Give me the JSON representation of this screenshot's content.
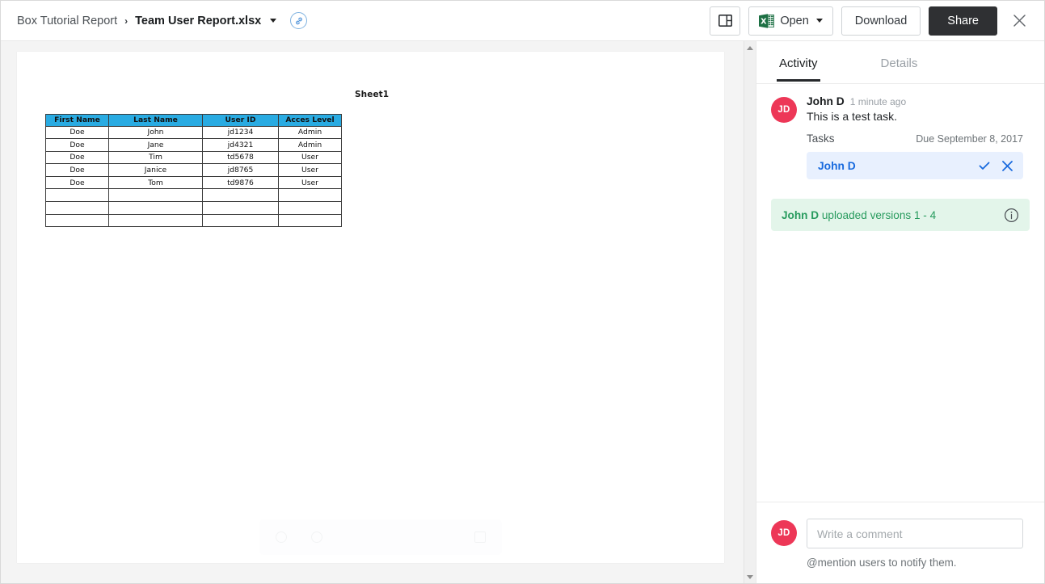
{
  "header": {
    "breadcrumb": {
      "parent": "Box Tutorial Report",
      "separator": "›",
      "current": "Team User Report.xlsx",
      "link_icon": "link-circle-icon",
      "caret_icon": "chevron-down-icon"
    },
    "actions": {
      "sidebar_toggle_icon": "sidebar-panel-icon",
      "open_label": "Open",
      "open_icon": "excel-file-icon",
      "download_label": "Download",
      "share_label": "Share",
      "close_icon": "close-icon"
    }
  },
  "viewer": {
    "sheet_label": "Sheet1",
    "zoom_out_icon": "zoom-out-icon",
    "zoom_in_icon": "zoom-in-icon",
    "fullscreen_icon": "fullscreen-icon",
    "scrollbar": {
      "up_icon": "scroll-up-arrow-icon",
      "down_icon": "scroll-down-arrow-icon"
    },
    "spreadsheet": {
      "headers": [
        "First Name",
        "Last Name",
        "User ID",
        "Acces Level"
      ],
      "header_bg": "#29abe2",
      "rows": [
        [
          "Doe",
          "John",
          "jd1234",
          "Admin"
        ],
        [
          "Doe",
          "Jane",
          "jd4321",
          "Admin"
        ],
        [
          "Doe",
          "Tim",
          "td5678",
          "User"
        ],
        [
          "Doe",
          "Janice",
          "jd8765",
          "User"
        ],
        [
          "Doe",
          "Tom",
          "td9876",
          "User"
        ],
        [
          "",
          "",
          "",
          ""
        ],
        [
          "",
          "",
          "",
          ""
        ],
        [
          "",
          "",
          "",
          ""
        ]
      ]
    }
  },
  "sidebar": {
    "tabs": [
      {
        "label": "Activity",
        "active": true
      },
      {
        "label": "Details",
        "active": false
      }
    ],
    "activity": {
      "avatar_initials": "JD",
      "avatar_color": "#ed3757",
      "author": "John D",
      "timestamp": "1 minute ago",
      "comment": "This is a test task.",
      "task_label": "Tasks",
      "task_due": "Due September 8, 2017",
      "assignee": {
        "name": "John D",
        "approve_icon": "check-icon",
        "reject_icon": "close-icon"
      }
    },
    "version_banner": {
      "author": "John D",
      "text": " uploaded versions 1 - 4",
      "info_icon": "info-circle-icon",
      "color": "#289b5e",
      "bg": "#e3f5ea"
    },
    "composer": {
      "avatar_initials": "JD",
      "placeholder": "Write a comment",
      "hint": "@mention users to notify them."
    }
  }
}
